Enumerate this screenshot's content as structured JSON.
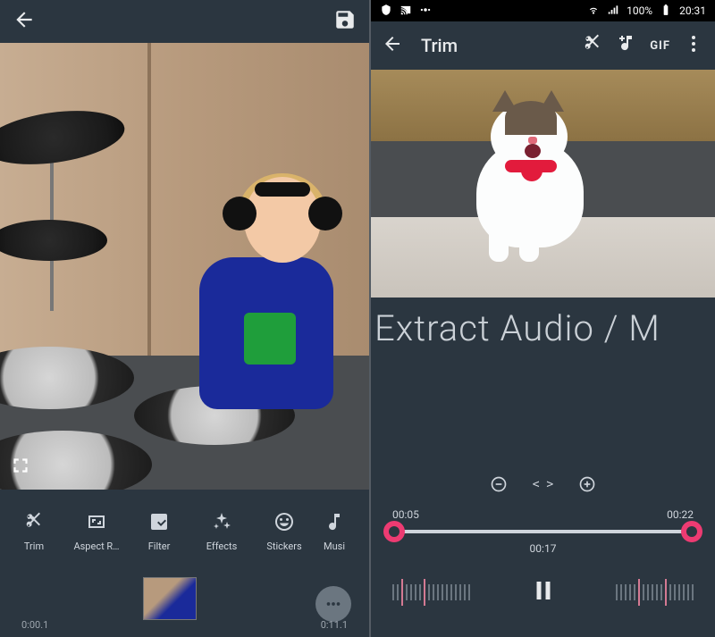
{
  "left": {
    "toolbar": {
      "trim": "Trim",
      "aspect": "Aspect R…",
      "filter": "Filter",
      "effects": "Effects",
      "stickers": "Stickers",
      "music": "Musi"
    },
    "timeline": {
      "start": "0:00.1",
      "end": "0:11.1"
    }
  },
  "right": {
    "status": {
      "battery": "100%",
      "time": "20:31"
    },
    "title": "Trim",
    "gif_label": "GIF",
    "caption": "Extract Audio / M",
    "zoom_code": "< >",
    "trim": {
      "start": "00:05",
      "end": "00:22",
      "current": "00:17"
    }
  }
}
